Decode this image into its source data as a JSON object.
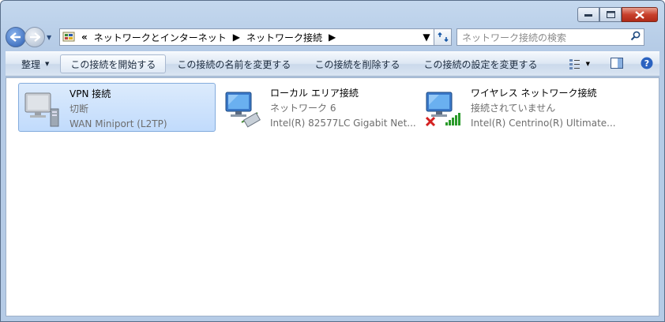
{
  "window": {
    "caption_buttons": {
      "minimize": "minimize",
      "maximize": "maximize",
      "close": "close"
    }
  },
  "address": {
    "prefix": "«",
    "crumbs": [
      "ネットワークとインターネット",
      "ネットワーク接続"
    ]
  },
  "search": {
    "placeholder": "ネットワーク接続の検索"
  },
  "toolbar": {
    "organize": "整理",
    "start": "この接続を開始する",
    "rename": "この接続の名前を変更する",
    "delete": "この接続を削除する",
    "settings": "この接続の設定を変更する"
  },
  "connections": [
    {
      "name": "VPN 接続",
      "status": "切断",
      "device": "WAN Miniport (L2TP)",
      "selected": true
    },
    {
      "name": "ローカル エリア接続",
      "status": "ネットワーク  6",
      "device": "Intel(R) 82577LC Gigabit Net...",
      "selected": false
    },
    {
      "name": "ワイヤレス ネットワーク接続",
      "status": "接続されていません",
      "device": "Intel(R) Centrino(R) Ultimate...",
      "selected": false
    }
  ],
  "colors": {
    "accent": "#1a5aa8",
    "selection": "#c1dbfc",
    "error": "#d42020",
    "signal": "#2a9a2a"
  }
}
